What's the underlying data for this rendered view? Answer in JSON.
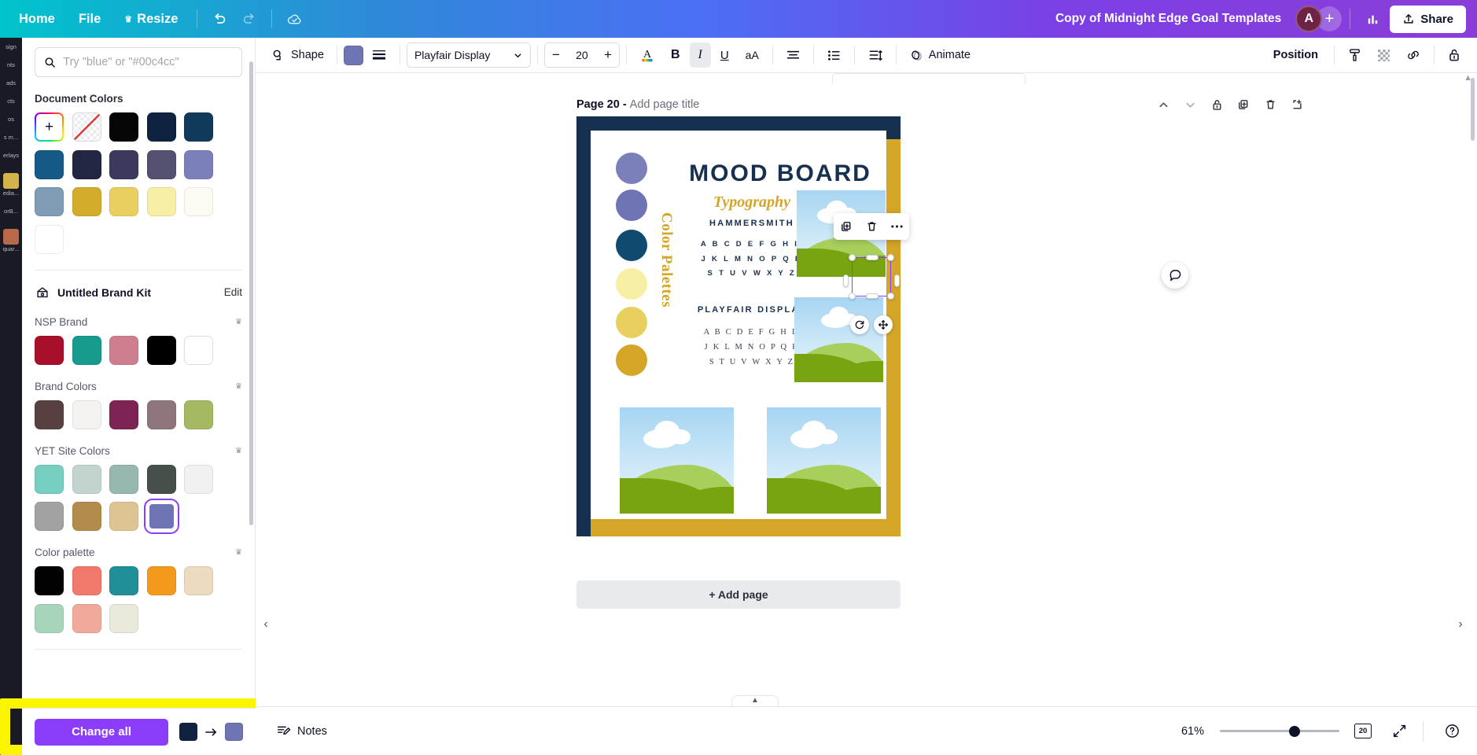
{
  "topbar": {
    "home": "Home",
    "file": "File",
    "resize": "Resize",
    "undo_icon": "undo-icon",
    "redo_icon": "redo-icon",
    "cloud_icon": "cloud-saved-icon",
    "doc_title": "Copy of Midnight Edge Goal Templates",
    "avatar_initial": "A",
    "add_collaborator": "+",
    "insights_icon": "insights-icon",
    "share_label": "Share",
    "share_icon": "upload-icon"
  },
  "toolbar": {
    "shape_label": "Shape",
    "shape_icon": "shape-icon",
    "fill_color": "#6e74b4",
    "lines_icon": "lines-icon",
    "font_family": "Playfair Display",
    "font_size": "20",
    "minus": "−",
    "plus": "+",
    "text_color_icon": "text-color-icon",
    "bold": "B",
    "italic": "I",
    "underline": "U",
    "case_label": "aA",
    "align_icon": "align-icon",
    "list_icon": "bulleted-list-icon",
    "spacing_icon": "line-spacing-icon",
    "animate_label": "Animate",
    "animate_icon": "animate-icon",
    "position_label": "Position",
    "paint_icon": "paint-roller-icon",
    "transparency_icon": "transparency-icon",
    "link_icon": "link-icon",
    "lock_icon": "lock-icon"
  },
  "rail": {
    "items": [
      {
        "label": "sign",
        "thumb": false
      },
      {
        "label": "nts",
        "thumb": false
      },
      {
        "label": "ads",
        "thumb": false
      },
      {
        "label": "cts",
        "thumb": false
      },
      {
        "label": "os",
        "thumb": false
      },
      {
        "label": "s m...",
        "thumb": false
      },
      {
        "label": "erlays",
        "thumb": false
      },
      {
        "label": "edia...",
        "thumb": true
      },
      {
        "label": "orB...",
        "thumb": false
      },
      {
        "label": "quar...",
        "thumb": true
      }
    ]
  },
  "panel": {
    "search_placeholder": "Try \"blue\" or \"#00c4cc\"",
    "search_value": "",
    "search_icon": "search-icon",
    "sections": [
      {
        "title": "Document Colors",
        "crown": false,
        "swatches": [
          {
            "type": "add",
            "color": "",
            "label": "+"
          },
          {
            "type": "none",
            "color": ""
          },
          {
            "type": "color",
            "color": "#050505"
          },
          {
            "type": "color",
            "color": "#0f2340"
          },
          {
            "type": "color",
            "color": "#103a5c"
          },
          {
            "type": "color",
            "color": "#155a86"
          },
          {
            "type": "color",
            "color": "#222642"
          },
          {
            "type": "color",
            "color": "#3b3a5e"
          },
          {
            "type": "color",
            "color": "#53516f"
          },
          {
            "type": "color",
            "color": "#7b80bb"
          },
          {
            "type": "color",
            "color": "#7f9cb5"
          },
          {
            "type": "color",
            "color": "#d4ac2c"
          },
          {
            "type": "color",
            "color": "#e9d05e"
          },
          {
            "type": "color",
            "color": "#f7f0a4"
          },
          {
            "type": "color",
            "color": "#fdfaf3"
          },
          {
            "type": "color",
            "color": "#ffffff"
          }
        ]
      }
    ],
    "brandkit": {
      "icon": "brand-kit-icon",
      "name": "Untitled Brand Kit",
      "edit": "Edit"
    },
    "groups": [
      {
        "title": "NSP Brand",
        "crown": true,
        "swatches": [
          "#a80f28",
          "#169b8c",
          "#ce7f8e",
          "#000000",
          "#ffffff"
        ]
      },
      {
        "title": "Brand Colors",
        "crown": true,
        "swatches": [
          "#57403f",
          "#f4f3f2",
          "#7e2455",
          "#8e757c",
          "#a5b862"
        ]
      },
      {
        "title": "YET Site Colors",
        "crown": true,
        "swatches": [
          "#79cec2",
          "#c2d4cd",
          "#96b8ae",
          "#474f4a",
          "#f1f1f1",
          "#a2a2a2",
          "#b28b4d",
          "#ddc492",
          "#6e74b4"
        ],
        "selected_index": 8
      },
      {
        "title": "Color palette",
        "crown": true,
        "swatches": [
          "#020202",
          "#f0796b",
          "#1f9099",
          "#f39a1c",
          "#eddbc0",
          "#a8d4bb",
          "#f0a99a",
          "#ebe9dc"
        ]
      }
    ],
    "change_all_label": "Change all",
    "change_from": "#0f2340",
    "change_to": "#6e74b4"
  },
  "canvas": {
    "page_label": "Page 20 -",
    "page_title_placeholder": "Add page title",
    "page_tools": [
      "chevron-up-icon",
      "chevron-down-icon",
      "lock-icon",
      "duplicate-icon",
      "trash-icon",
      "expand-page-icon"
    ],
    "selection_tools": [
      "duplicate-icon",
      "trash-icon",
      "more-options-icon"
    ],
    "rotate_icon": "rotate-icon",
    "move_icon": "move-icon",
    "comment_icon": "comment-icon",
    "add_page_label": "+ Add page",
    "design": {
      "title": "MOOD BOARD",
      "typography_heading": "Typography",
      "vertical_label": "Color Palettes",
      "font_1_name": "HAMMERSMITH",
      "font_1_alphabet": [
        "A B C D E F G H I,",
        "J K L M N O P Q R",
        "S T U V W X Y Z"
      ],
      "font_2_name": "PLAYFAIR DISPLAY",
      "font_2_alphabet": [
        "A B C D E F G H I,",
        "J K L M N O P Q R",
        "S T U V W X Y Z"
      ],
      "frame_color": "#16304f",
      "accent_color": "#d4a526",
      "dots": [
        "#7b80bb",
        "#6e74b4",
        "#104a6e",
        "#f7f0a4",
        "#e9d05e",
        "#d4a526"
      ]
    }
  },
  "statusbar": {
    "notes_label": "Notes",
    "notes_icon": "notes-icon",
    "zoom_percent": "61%",
    "page_count": "20",
    "grid_icon": "page-grid-icon",
    "fullscreen_icon": "fullscreen-icon",
    "help_icon": "help-icon"
  }
}
